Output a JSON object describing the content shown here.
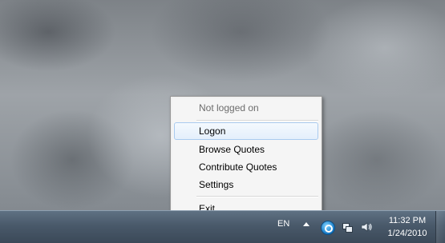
{
  "context_menu": {
    "status_label": "Not logged on",
    "items": [
      {
        "label": "Logon"
      },
      {
        "label": "Browse Quotes"
      },
      {
        "label": "Contribute Quotes"
      },
      {
        "label": "Settings"
      },
      {
        "label": "Exit"
      }
    ]
  },
  "taskbar": {
    "language": "EN",
    "clock_time": "11:32 PM",
    "clock_date": "1/24/2010",
    "tray_icons": [
      "show-hidden-icons-arrow",
      "quotes-app-icon",
      "network-icon",
      "volume-icon"
    ]
  },
  "colors": {
    "taskbar": "#4a5a6b",
    "menu_background": "#f1f1f1",
    "menu_hover": "#e4effb",
    "menu_hover_border": "#aacbef"
  }
}
